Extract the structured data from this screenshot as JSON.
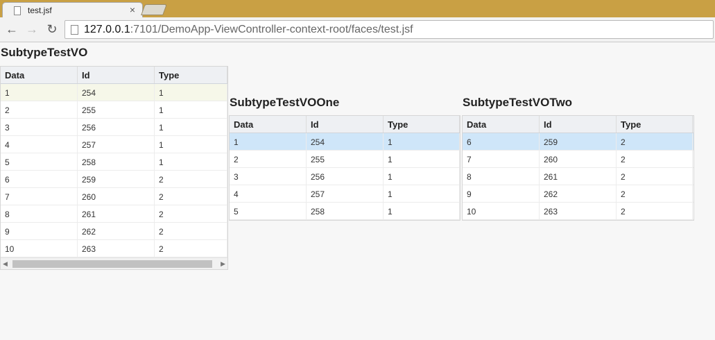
{
  "browser": {
    "tab_title": "test.jsf",
    "close_glyph": "×",
    "url_host": "127.0.0.1",
    "url_rest": ":7101/DemoApp-ViewController-context-root/faces/test.jsf",
    "back_icon": "arrow-left-icon",
    "forward_icon": "arrow-right-icon",
    "reload_icon": "reload-icon"
  },
  "tables": {
    "main": {
      "title": "SubtypeTestVO",
      "headers": [
        "Data",
        "Id",
        "Type"
      ],
      "rows": [
        [
          "1",
          "254",
          "1"
        ],
        [
          "2",
          "255",
          "1"
        ],
        [
          "3",
          "256",
          "1"
        ],
        [
          "4",
          "257",
          "1"
        ],
        [
          "5",
          "258",
          "1"
        ],
        [
          "6",
          "259",
          "2"
        ],
        [
          "7",
          "260",
          "2"
        ],
        [
          "8",
          "261",
          "2"
        ],
        [
          "9",
          "262",
          "2"
        ],
        [
          "10",
          "263",
          "2"
        ]
      ]
    },
    "one": {
      "title": "SubtypeTestVOOne",
      "headers": [
        "Data",
        "Id",
        "Type"
      ],
      "rows": [
        [
          "1",
          "254",
          "1"
        ],
        [
          "2",
          "255",
          "1"
        ],
        [
          "3",
          "256",
          "1"
        ],
        [
          "4",
          "257",
          "1"
        ],
        [
          "5",
          "258",
          "1"
        ]
      ]
    },
    "two": {
      "title": "SubtypeTestVOTwo",
      "headers": [
        "Data",
        "Id",
        "Type"
      ],
      "rows": [
        [
          "6",
          "259",
          "2"
        ],
        [
          "7",
          "260",
          "2"
        ],
        [
          "8",
          "261",
          "2"
        ],
        [
          "9",
          "262",
          "2"
        ],
        [
          "10",
          "263",
          "2"
        ]
      ]
    }
  },
  "colors": {
    "titlebar": "#c9a044",
    "selected_row": "#cfe6f9",
    "hover_row": "#f6f7e9"
  }
}
